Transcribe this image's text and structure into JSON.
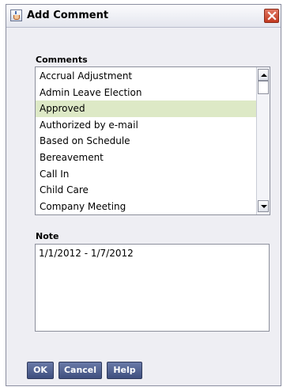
{
  "window": {
    "title": "Add Comment"
  },
  "comments": {
    "label": "Comments",
    "items": [
      "Accrual Adjustment",
      "Admin Leave Election",
      "Approved",
      "Authorized by e-mail",
      "Based on Schedule",
      "Bereavement",
      "Call In",
      "Child Care",
      "Company Meeting"
    ],
    "selected": "Approved"
  },
  "note": {
    "label": "Note",
    "value": "1/1/2012 - 1/7/2012"
  },
  "buttons": {
    "ok": "OK",
    "cancel": "Cancel",
    "help": "Help"
  },
  "icons": {
    "app": "java-cup-icon",
    "close": "close-icon",
    "scroll_up": "chevron-up-icon",
    "scroll_down": "chevron-down-icon"
  },
  "colors": {
    "selected_row": "#dde9c6",
    "button_bg": "#4a5a8a",
    "close_bg": "#d0503a"
  }
}
